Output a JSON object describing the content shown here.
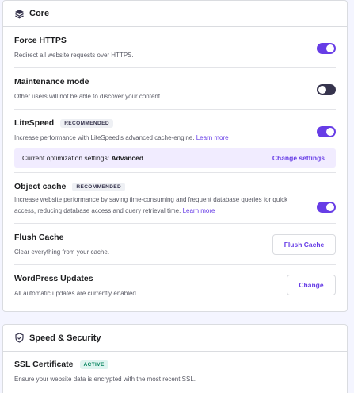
{
  "core": {
    "title": "Core",
    "icon": "layers-icon",
    "accent": "#673de6",
    "rows": {
      "force_https": {
        "title": "Force HTTPS",
        "desc": "Redirect all website requests over HTTPS.",
        "enabled": true
      },
      "maintenance": {
        "title": "Maintenance mode",
        "desc": "Other users will not be able to discover your content.",
        "enabled": false
      },
      "litespeed": {
        "title": "LiteSpeed",
        "badge": "RECOMMENDED",
        "desc": "Increase performance with LiteSpeed's advanced cache-engine.",
        "link": "Learn more",
        "enabled": true,
        "optimization": {
          "label": "Current optimization settings:",
          "value": "Advanced",
          "action": "Change settings"
        }
      },
      "object_cache": {
        "title": "Object cache",
        "badge": "RECOMMENDED",
        "desc_line1": "Increase website performance by saving time-consuming and frequent database queries for quick",
        "desc_line2": "access, reducing database access and query retrieval time.",
        "link": "Learn more",
        "enabled": true
      },
      "flush_cache": {
        "title": "Flush Cache",
        "desc": "Clear everything from your cache.",
        "button": "Flush Cache"
      },
      "wp_updates": {
        "title": "WordPress Updates",
        "desc": "All automatic updates are currently enabled",
        "button": "Change"
      }
    }
  },
  "speed": {
    "title": "Speed & Security",
    "icon": "shield-icon",
    "rows": {
      "ssl": {
        "title": "SSL Certificate",
        "badge": "ACTIVE",
        "badge_color": "#00815a",
        "desc": "Ensure your website data is encrypted with the most recent SSL."
      }
    }
  }
}
